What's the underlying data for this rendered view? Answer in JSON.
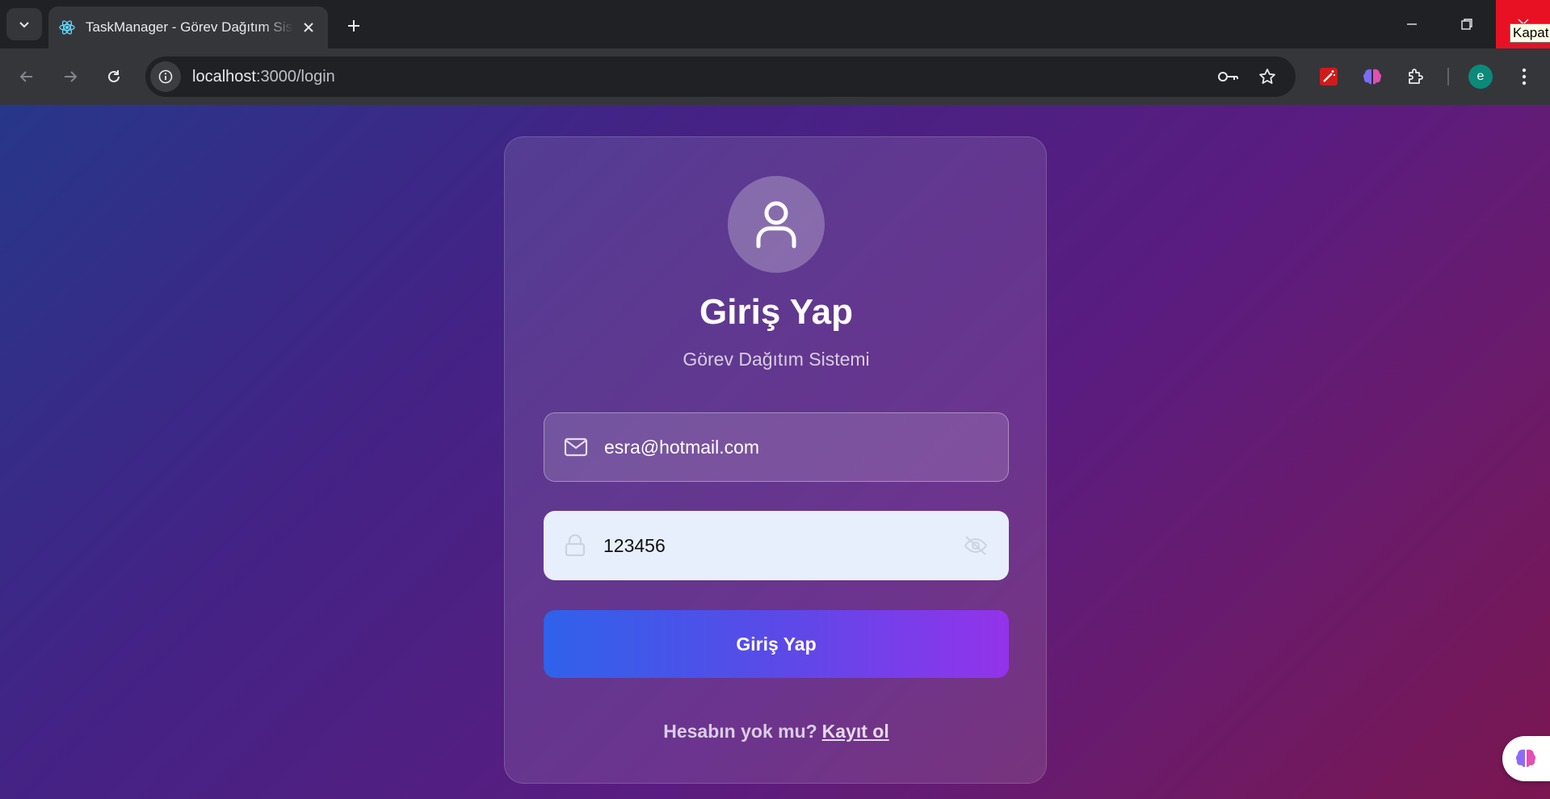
{
  "browser": {
    "tab": {
      "title": "TaskManager - Görev Dağıtım Sistemi"
    },
    "tooltip": "Kapat",
    "omnibox": {
      "host": "localhost",
      "path": ":3000/login"
    },
    "profile_initial": "e"
  },
  "login": {
    "title": "Giriş Yap",
    "subtitle": "Görev Dağıtım Sistemi",
    "email": {
      "value": "esra@hotmail.com",
      "icon": "mail-icon"
    },
    "password": {
      "value": "123456",
      "icon": "lock-icon",
      "toggle_icon": "eye-off-icon"
    },
    "submit_label": "Giriş Yap",
    "register_prompt": "Hesabın yok mu?",
    "register_link": "Kayıt ol"
  },
  "colors": {
    "accent_start": "#2f62ea",
    "accent_end": "#9333ea",
    "close_red": "#e81123"
  }
}
